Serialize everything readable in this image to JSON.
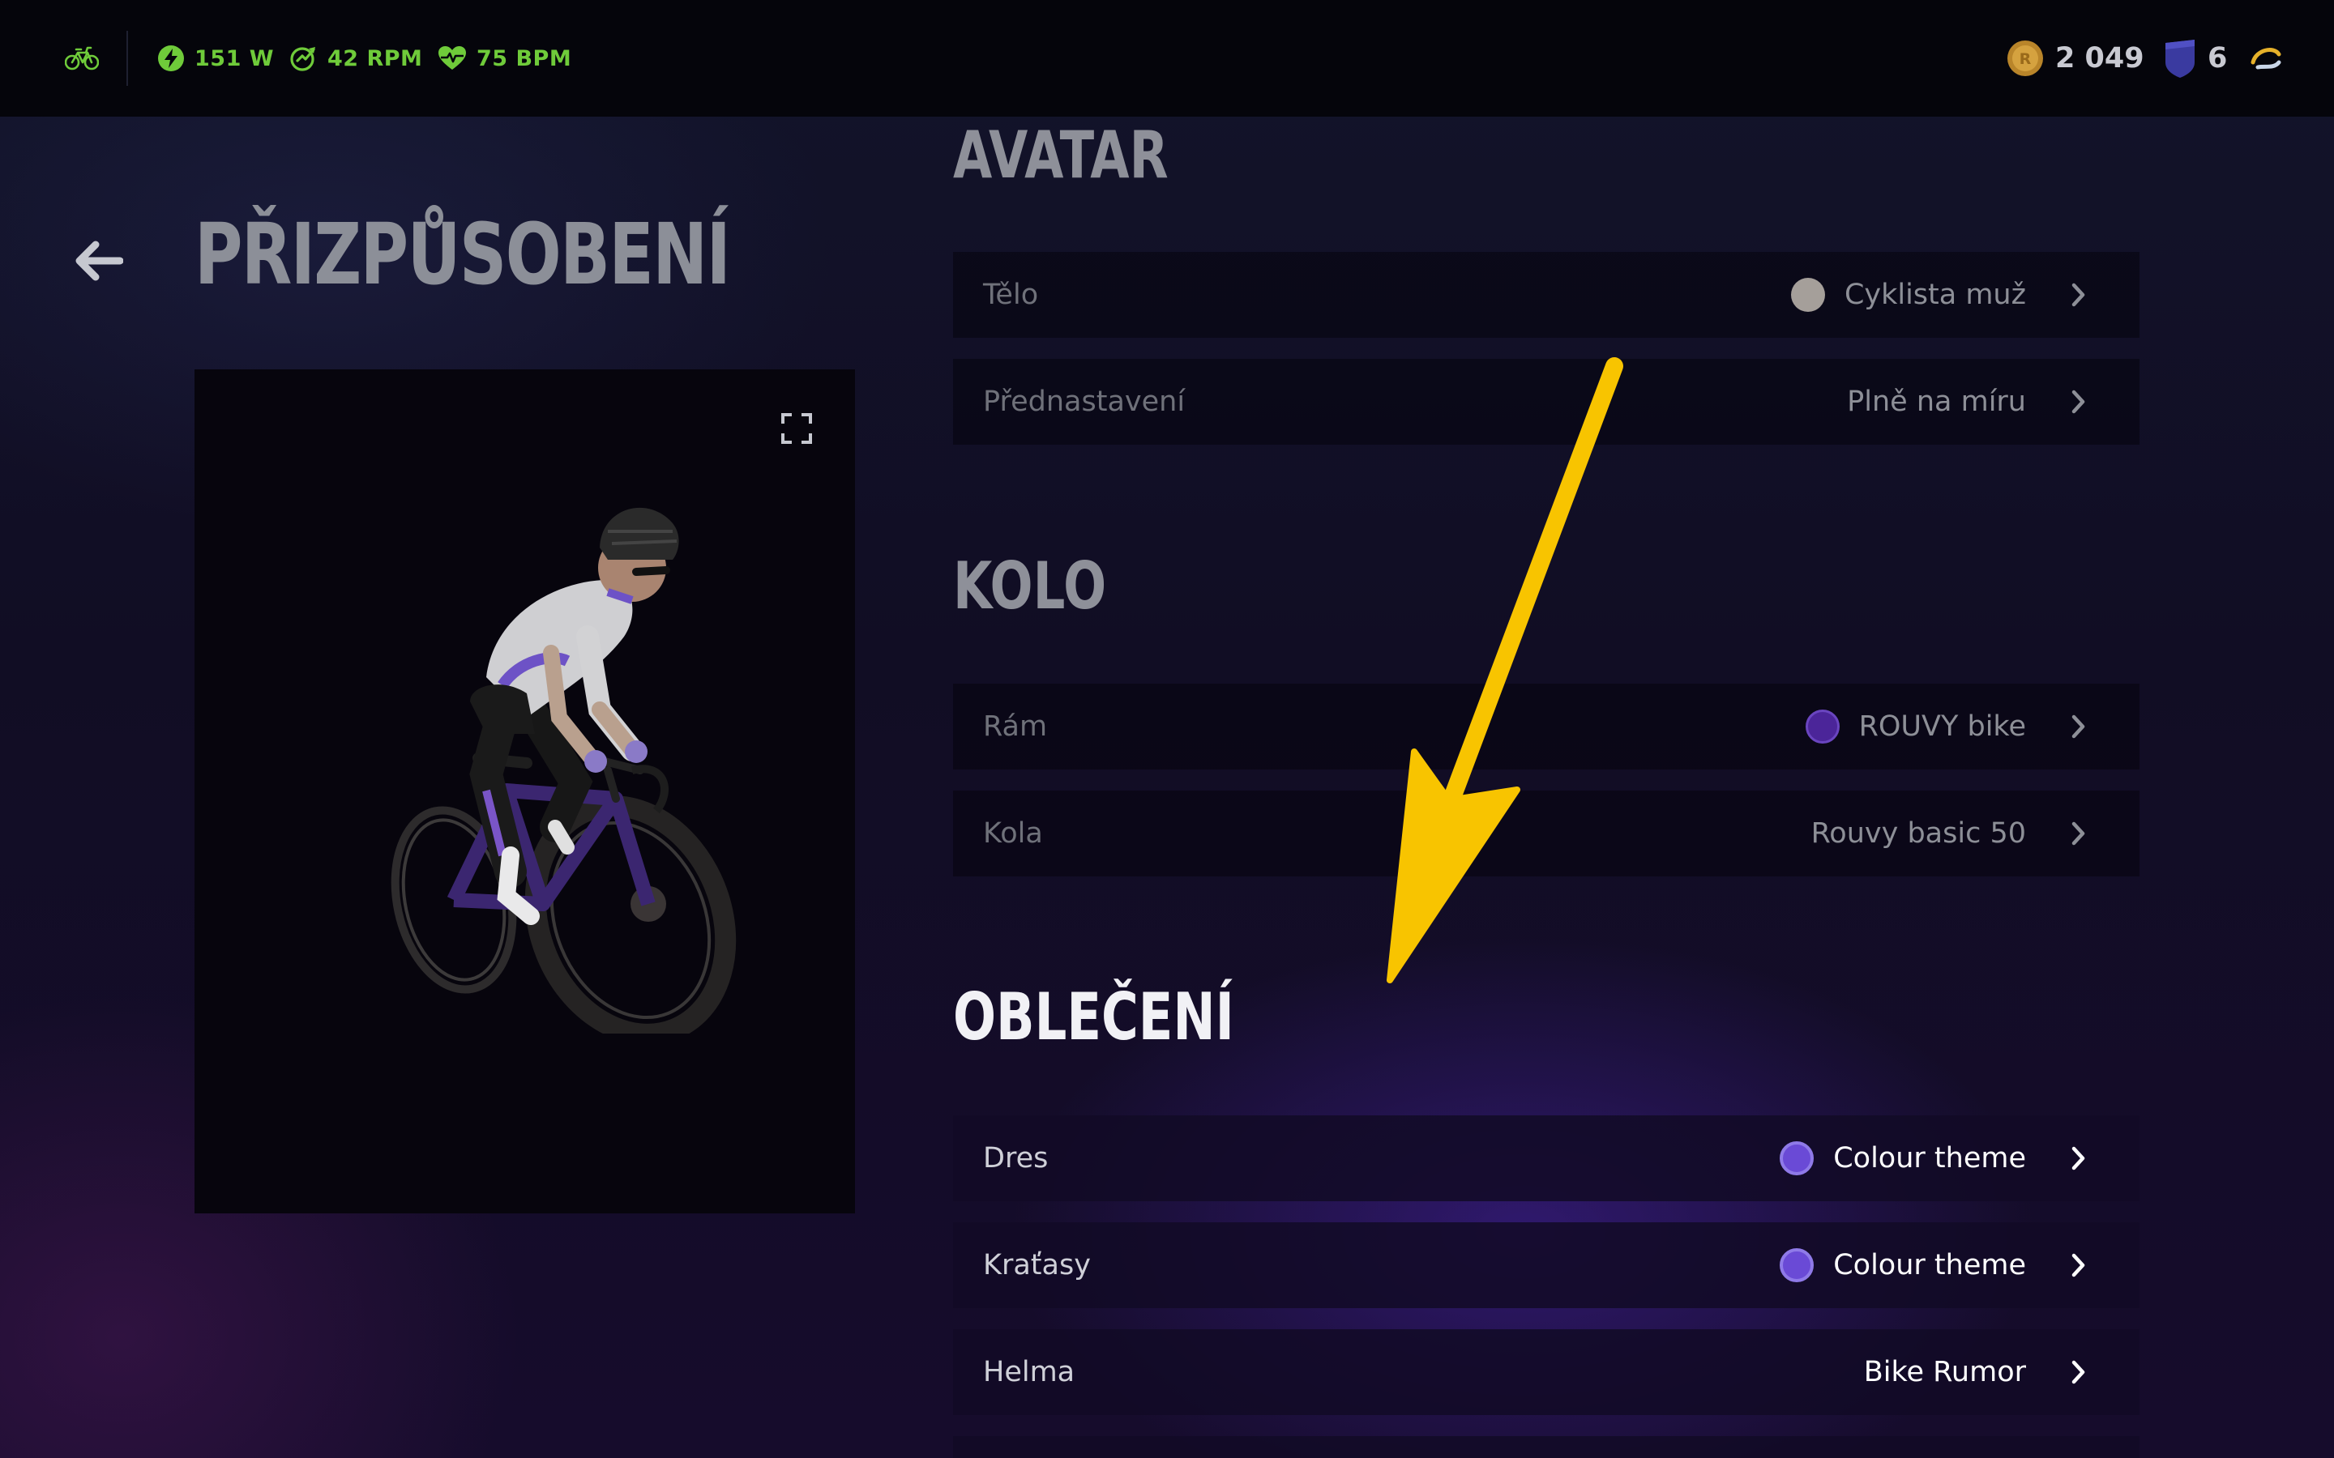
{
  "topbar": {
    "icons": [
      "bike-icon",
      "power-icon",
      "cadence-icon",
      "heart-rate-icon",
      "coin-icon",
      "shield-icon",
      "rouvy-logo"
    ],
    "power": "151 W",
    "cadence": "42 RPM",
    "heart_rate": "75 BPM",
    "coins": "2 049",
    "level": "6"
  },
  "page": {
    "title": "PŘIZPŮSOBENÍ",
    "back_icon": "arrow-left-icon",
    "expand_icon": "fullscreen-icon"
  },
  "sections": {
    "avatar": {
      "title": "AVATAR",
      "rows": [
        {
          "label": "Tělo",
          "value": "Cyklista muž",
          "swatch": "#a59f9a"
        },
        {
          "label": "Přednastavení",
          "value": "Plně na míru"
        }
      ]
    },
    "bike": {
      "title": "KOLO",
      "rows": [
        {
          "label": "Rám",
          "value": "ROUVY bike",
          "swatch": "#4b2599"
        },
        {
          "label": "Kola",
          "value": "Rouvy basic 50"
        }
      ]
    },
    "clothing": {
      "title": "OBLEČENÍ",
      "rows": [
        {
          "label": "Dres",
          "value": "Colour theme",
          "swatch": "#6a4ad6"
        },
        {
          "label": "Kraťasy",
          "value": "Colour theme",
          "swatch": "#6a4ad6"
        },
        {
          "label": "Helma",
          "value": "Bike Rumor"
        }
      ]
    }
  },
  "colors": {
    "accent_green": "#6fcb3a",
    "annotation_arrow": "#f8c400",
    "background": "#12102a"
  }
}
